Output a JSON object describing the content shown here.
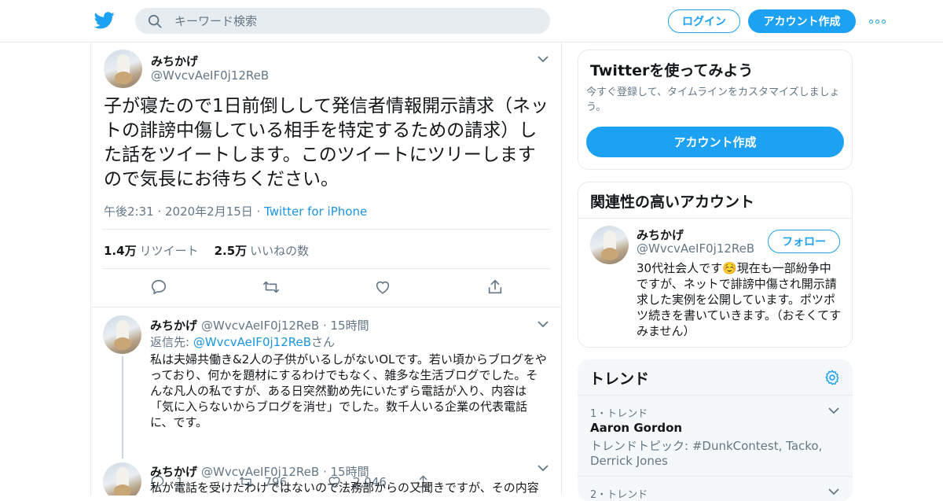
{
  "header": {
    "search_placeholder": "キーワード検索",
    "login_label": "ログイン",
    "signup_label": "アカウント作成"
  },
  "main_tweet": {
    "name": "みちかげ",
    "handle": "@WvcvAeIF0j12ReB",
    "text": "子が寝たので1日前倒しして発信者情報開示請求（ネットの誹謗中傷している相手を特定するための請求）した話をツイートします。このツイートにツリーしますので気長にお待ちください。",
    "time": "午後2:31 · 2020年2月15日 · ",
    "source": "Twitter for iPhone",
    "retweets_count": "1.4万",
    "retweets_label": "リツイート",
    "likes_count": "2.5万",
    "likes_label": "いいねの数"
  },
  "replies": [
    {
      "name": "みちかげ",
      "handle": "@WvcvAeIF0j12ReB · 15時間",
      "reply_prefix": "返信先: ",
      "reply_to": "@WvcvAeIF0j12ReB",
      "reply_suffix": "さん",
      "text": "私は夫婦共働き&2人の子供がいるしがないOLです。若い頃からブログをやっており、何かを題材にするわけでもなく、雑多な生活ブログでした。そんな凡人の私ですが、ある日突然勤め先にいたずら電話が入り、内容は「気に入らないからブログを消せ」でした。数千人いる企業の代表電話に、です。",
      "reply_count": "1",
      "retweet_count": "796",
      "like_count": "2,046"
    },
    {
      "name": "みちかげ",
      "handle": "@WvcvAeIF0j12ReB · 15時間",
      "text": "私が電話を受けたわけではないので法務部からの又聞きですが、その内容"
    }
  ],
  "signup_card": {
    "title": "Twitterを使ってみよう",
    "description": "今すぐ登録して、タイムラインをカスタマイズしましょう。",
    "button": "アカウント作成"
  },
  "related_card": {
    "title": "関連性の高いアカウント",
    "name": "みちかげ",
    "handle": "@WvcvAeIF0j12ReB",
    "follow_button": "フォロー",
    "bio": "30代社会人です☺️現在も一部紛争中ですが、ネットで誹謗中傷され開示請求した実例を公開しています。ポツポツ続きを書いていきます。（おそくてすみません）"
  },
  "trends_card": {
    "title": "トレンド",
    "items": [
      {
        "rank": "1・トレンド",
        "name": "Aaron Gordon",
        "desc": "トレンドトピック: #DunkContest, Tacko, Derrick Jones"
      },
      {
        "rank": "2・トレンド"
      }
    ]
  },
  "colors": {
    "accent": "#1da1f2",
    "link": "#1b95e0",
    "muted": "#657786",
    "border": "#e6ecf0"
  }
}
